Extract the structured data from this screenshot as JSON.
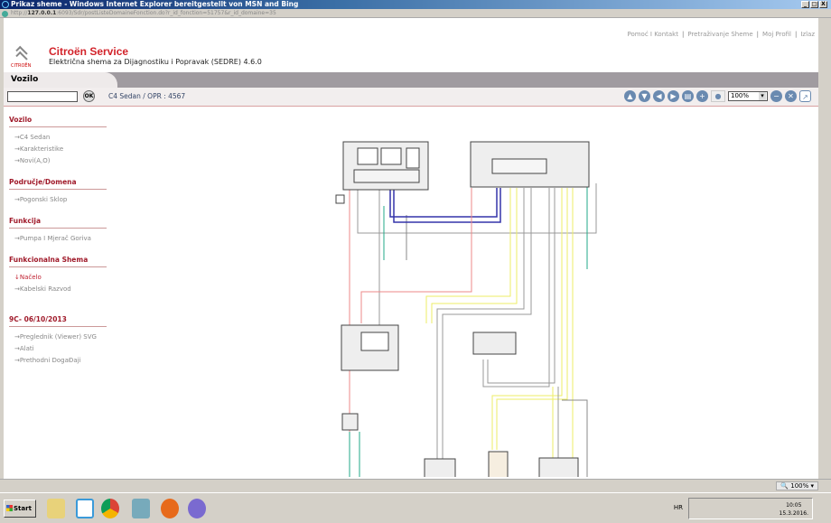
{
  "window": {
    "title": "Prikaz sheme - Windows Internet Explorer bereitgestellt von MSN and Bing",
    "url_host": "127.0.0.1",
    "url_rest": ":6093/Sdr/postListeDomaineFonction.do?r_id_fonction=51757&r_id_domaine=35",
    "buttons": [
      "_",
      "□",
      "X"
    ]
  },
  "header": {
    "links": [
      "Pomoć I Kontakt",
      "Pretraživanje Sheme",
      "Moj Profil",
      "Izlaz"
    ],
    "logo_text": "CITROËN",
    "brand": "Citroën Service",
    "subtitle": "Električna shema za Dijagnostiku i Popravak (SEDRE) 4.6.0"
  },
  "tab": {
    "label": "Vozilo"
  },
  "toolbar": {
    "search_value": "",
    "ok_label": "OK",
    "breadcrumb": "C4 Sedan  /  OPR : 4567",
    "zoom": "100%",
    "icons": [
      "up-icon",
      "down-icon",
      "left-icon",
      "right-icon",
      "print-icon",
      "zoom-in-icon",
      "magnifier-icon",
      "zoom-out-icon",
      "reset-icon",
      "export-icon"
    ]
  },
  "sidebar": {
    "sections": [
      {
        "title": "Vozilo",
        "items": [
          {
            "label": "→C4 Sedan"
          },
          {
            "label": "→Karakteristike"
          },
          {
            "label": "→Novi(A,O)"
          }
        ]
      },
      {
        "title": "Područje/Domena",
        "items": [
          {
            "label": "→Pogonski Sklop"
          }
        ]
      },
      {
        "title": "Funkcija",
        "items": [
          {
            "label": "→Pumpa I Mjerač Goriva"
          }
        ]
      },
      {
        "title": "Funkcionalna Shema",
        "items": [
          {
            "label": "↓Načelo",
            "active": true
          },
          {
            "label": "→Kabelski Razvod"
          }
        ]
      },
      {
        "title": "9C- 06/10/2013",
        "items": [
          {
            "label": "→Preglednik (Viewer) SVG"
          },
          {
            "label": "→Alati"
          },
          {
            "label": "→Prethodni DogaĐaji"
          }
        ]
      }
    ]
  },
  "status": {
    "zoom": "100%"
  },
  "taskbar": {
    "start": "Start",
    "lang": "HR",
    "time": "10:05",
    "date": "15.3.2016."
  },
  "colors": {
    "brand": "#d2232a",
    "section": "#a01a2a",
    "tool": "#6a8ab0"
  }
}
